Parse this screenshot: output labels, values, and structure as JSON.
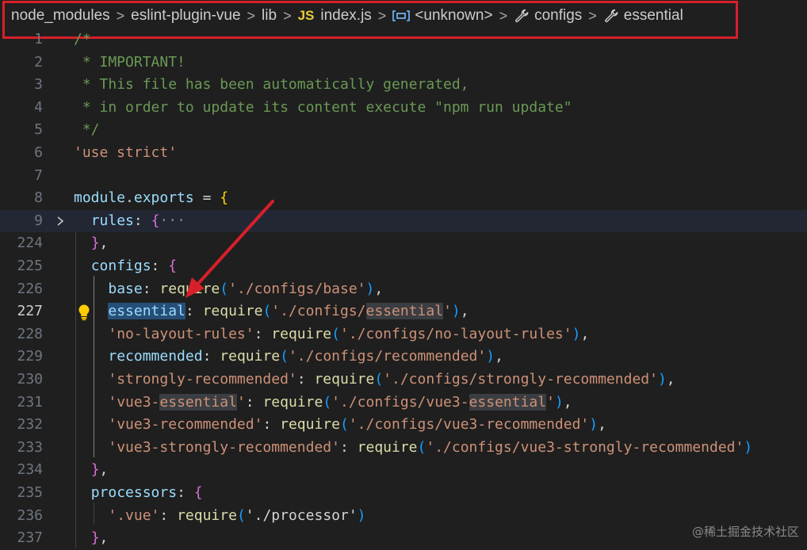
{
  "breadcrumb": {
    "items": [
      {
        "label": "node_modules"
      },
      {
        "label": "eslint-plugin-vue"
      },
      {
        "label": "lib"
      },
      {
        "label": "index.js",
        "badge": "JS"
      },
      {
        "label": "<unknown>",
        "icon": "symbol-variable-icon"
      },
      {
        "label": "configs",
        "icon": "wrench-icon"
      },
      {
        "label": "essential",
        "icon": "wrench-icon"
      }
    ],
    "separator": ">"
  },
  "editor": {
    "lines": [
      {
        "number": "1",
        "text": "/*"
      },
      {
        "number": "2",
        "text": " * IMPORTANT!"
      },
      {
        "number": "3",
        "text": " * This file has been automatically generated,"
      },
      {
        "number": "4",
        "text": " * in order to update its content execute \"npm run update\""
      },
      {
        "number": "5",
        "text": " */"
      },
      {
        "number": "6",
        "text": "'use strict'"
      },
      {
        "number": "7",
        "text": ""
      },
      {
        "number": "8",
        "text": "module.exports = {"
      },
      {
        "number": "9",
        "text": "  rules: {···"
      },
      {
        "number": "224",
        "text": "  },"
      },
      {
        "number": "225",
        "text": "  configs: {"
      },
      {
        "number": "226",
        "text": "    base: require('./configs/base'),"
      },
      {
        "number": "227",
        "text": "    essential: require('./configs/essential'),"
      },
      {
        "number": "228",
        "text": "    'no-layout-rules': require('./configs/no-layout-rules'),"
      },
      {
        "number": "229",
        "text": "    recommended: require('./configs/recommended'),"
      },
      {
        "number": "230",
        "text": "    'strongly-recommended': require('./configs/strongly-recommended'),"
      },
      {
        "number": "231",
        "text": "    'vue3-essential': require('./configs/vue3-essential'),"
      },
      {
        "number": "232",
        "text": "    'vue3-recommended': require('./configs/vue3-recommended'),"
      },
      {
        "number": "233",
        "text": "    'vue3-strongly-recommended': require('./configs/vue3-strongly-recommended')"
      },
      {
        "number": "234",
        "text": "  },"
      },
      {
        "number": "235",
        "text": "  processors: {"
      },
      {
        "number": "236",
        "text": "    '.vue': require('./processor')"
      },
      {
        "number": "237",
        "text": "  },"
      }
    ],
    "current_line": "227",
    "folded_line": "9"
  },
  "colors": {
    "annotation": "#d7202a",
    "background": "#1f1f1f",
    "selection": "#264f78"
  },
  "watermark": "@稀土掘金技术社区"
}
